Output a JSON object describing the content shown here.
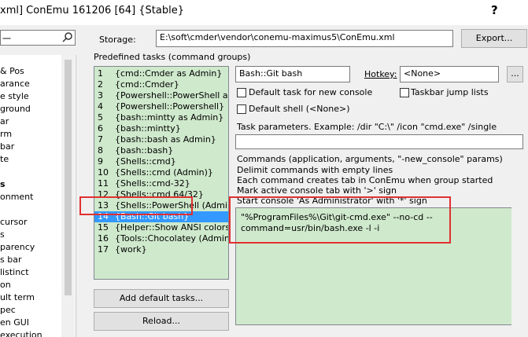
{
  "window": {
    "title": "xml] ConEmu 161206 [64] {Stable}",
    "help_glyph": "?"
  },
  "left": {
    "search_value": "一",
    "items": [
      "& Pos",
      "arance",
      "e style",
      "ground",
      "ar",
      "rm",
      "bar",
      "te",
      "s",
      "onment",
      "",
      "cursor",
      "s",
      "parency",
      "s bar",
      "listinct",
      "on",
      "ult term",
      "pec",
      "en GUI",
      "execution"
    ]
  },
  "storage": {
    "label": "Storage:",
    "path": "E:\\soft\\cmder\\vendor\\conemu-maximus5\\ConEmu.xml",
    "export_label": "Export..."
  },
  "tasks": {
    "group_label": "Predefined tasks (command groups)",
    "items": [
      {
        "num": "1",
        "name": "{cmd::Cmder as Admin}"
      },
      {
        "num": "2",
        "name": "{cmd::Cmder}"
      },
      {
        "num": "3",
        "name": "{Powershell::PowerShell as Ad"
      },
      {
        "num": "4",
        "name": "{Powershell::Powershell}"
      },
      {
        "num": "5",
        "name": "{bash::mintty as Admin}"
      },
      {
        "num": "6",
        "name": "{bash::mintty}"
      },
      {
        "num": "7",
        "name": "{bash::bash as Admin}"
      },
      {
        "num": "8",
        "name": "{bash::bash}"
      },
      {
        "num": "9",
        "name": "{Shells::cmd}"
      },
      {
        "num": "10",
        "name": "{Shells::cmd (Admin)}"
      },
      {
        "num": "11",
        "name": "{Shells::cmd-32}"
      },
      {
        "num": "12",
        "name": "{Shells::cmd 64/32}"
      },
      {
        "num": "13",
        "name": "{Shells::PowerShell (Admin)}"
      },
      {
        "num": "14",
        "name": "{Bash::Git bash}"
      },
      {
        "num": "15",
        "name": "{Helper::Show ANSI colors}"
      },
      {
        "num": "16",
        "name": "{Tools::Chocolatey (Admin)}"
      },
      {
        "num": "17",
        "name": "{work}"
      }
    ],
    "selected_index": 13,
    "add_default_label": "Add default tasks...",
    "reload_label": "Reload..."
  },
  "task_editor": {
    "name_value": "Bash::Git bash",
    "hotkey_label": "Hotkey:",
    "hotkey_value": "<None>",
    "hotkey_btn_label": "...",
    "default_task_label": "Default task for new console",
    "taskbar_jump_label": "Taskbar jump lists",
    "default_shell_label": "Default shell (<None>)",
    "params_label": "Task parameters. Example: /dir \"C:\\\" /icon \"cmd.exe\" /single",
    "params_value": "",
    "commands_help": [
      "Commands (application, arguments, \"-new_console\" params)",
      "Delimit commands with empty lines",
      "Each command creates tab in ConEmu when group started",
      "Mark active console tab with '>' sign",
      "Start console 'As Administrator' with '*' sign"
    ],
    "command_text": "\"%ProgramFiles%\\Git\\git-cmd.exe\" --no-cd --command=usr/bin/bash.exe -l -i"
  },
  "colors": {
    "list_bg": "#cfe9cc",
    "selection": "#3399ff",
    "highlight_box": "#e03030"
  }
}
